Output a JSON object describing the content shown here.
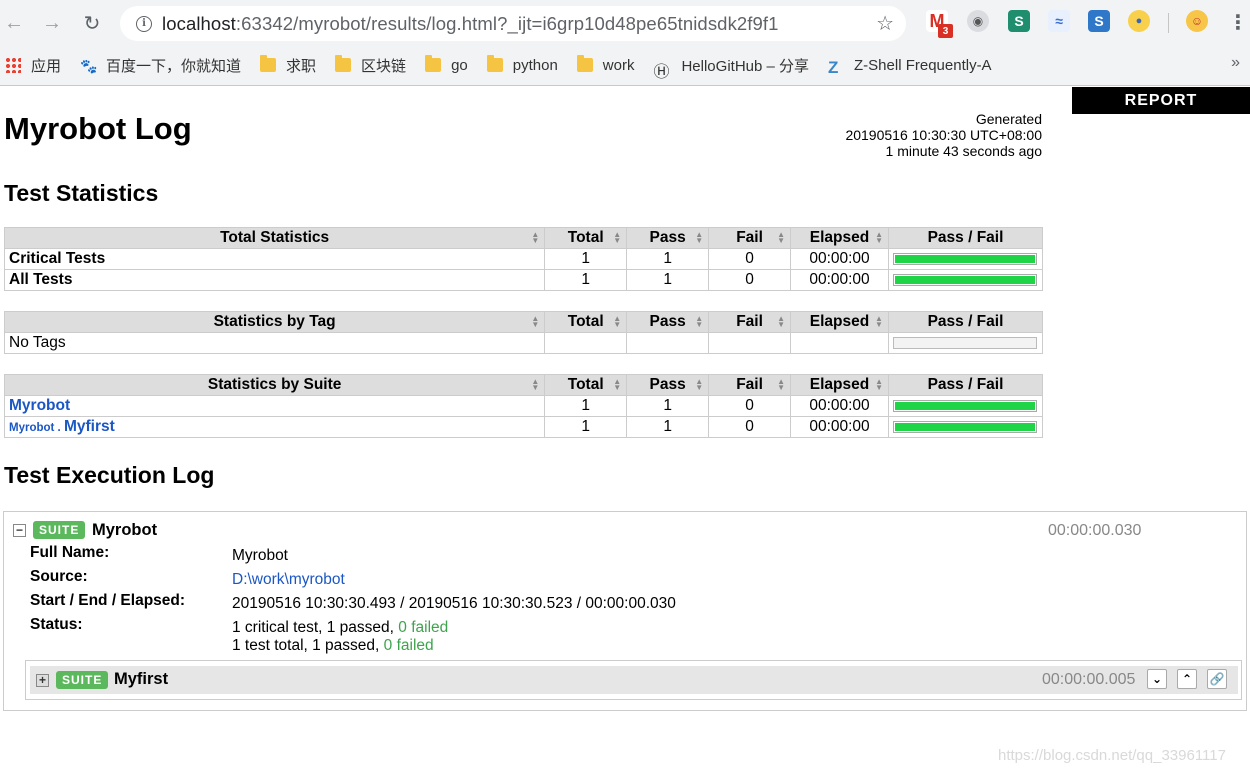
{
  "browser": {
    "url_host": "localhost",
    "url_rest": ":63342/myrobot/results/log.html?_ijt=i6grp10d48pe65tnidsdk2f9f1",
    "gmail_badge": "3",
    "bookmarks": [
      {
        "label": "应用",
        "icon": "apps-grid-icon"
      },
      {
        "label": "百度一下，你就知道",
        "icon": "baidu-paw-icon"
      },
      {
        "label": "求职",
        "icon": "folder-icon"
      },
      {
        "label": "区块链",
        "icon": "folder-icon"
      },
      {
        "label": "go",
        "icon": "folder-icon"
      },
      {
        "label": "python",
        "icon": "folder-icon"
      },
      {
        "label": "work",
        "icon": "folder-icon"
      },
      {
        "label": "HelloGitHub – 分享",
        "icon": "hellogithub-icon"
      },
      {
        "label": "Z-Shell Frequently-A",
        "icon": "zshell-icon"
      }
    ],
    "overflow": "»"
  },
  "report_link": "REPORT",
  "title": "Myrobot Log",
  "generated": {
    "label": "Generated",
    "timestamp": "20190516 10:30:30 UTC+08:00",
    "ago": "1 minute 43 seconds ago"
  },
  "sections": {
    "statistics": "Test Statistics",
    "execution": "Test Execution Log"
  },
  "columns": {
    "total": "Total",
    "pass": "Pass",
    "fail": "Fail",
    "elapsed": "Elapsed",
    "graph": "Pass / Fail"
  },
  "total_statistics": {
    "header": "Total Statistics",
    "rows": [
      {
        "name": "Critical Tests",
        "total": "1",
        "pass": "1",
        "fail": "0",
        "elapsed": "00:00:00",
        "pass_ratio": 1.0
      },
      {
        "name": "All Tests",
        "total": "1",
        "pass": "1",
        "fail": "0",
        "elapsed": "00:00:00",
        "pass_ratio": 1.0
      }
    ]
  },
  "tag_statistics": {
    "header": "Statistics by Tag",
    "empty_text": "No Tags"
  },
  "suite_statistics": {
    "header": "Statistics by Suite",
    "rows": [
      {
        "parent": "",
        "name": "Myrobot",
        "total": "1",
        "pass": "1",
        "fail": "0",
        "elapsed": "00:00:00",
        "pass_ratio": 1.0
      },
      {
        "parent": "Myrobot . ",
        "name": "Myfirst",
        "total": "1",
        "pass": "1",
        "fail": "0",
        "elapsed": "00:00:00",
        "pass_ratio": 1.0
      }
    ]
  },
  "suite": {
    "toggle": "−",
    "badge": "SUITE",
    "name": "Myrobot",
    "elapsed": "00:00:00.030",
    "full_name_label": "Full Name:",
    "full_name": "Myrobot",
    "source_label": "Source:",
    "source": "D:\\work\\myrobot",
    "times_label": "Start / End / Elapsed:",
    "times": "20190516 10:30:30.493 / 20190516 10:30:30.523 / 00:00:00.030",
    "status_label": "Status:",
    "status_line1_prefix": "1 critical test, 1 passed, ",
    "status_line1_failed": "0 failed",
    "status_line2_prefix": "1 test total, 1 passed, ",
    "status_line2_failed": "0 failed",
    "child": {
      "toggle": "+",
      "badge": "SUITE",
      "name": "Myfirst",
      "elapsed": "00:00:00.005"
    }
  },
  "watermark": "https://blog.csdn.net/qq_33961117"
}
